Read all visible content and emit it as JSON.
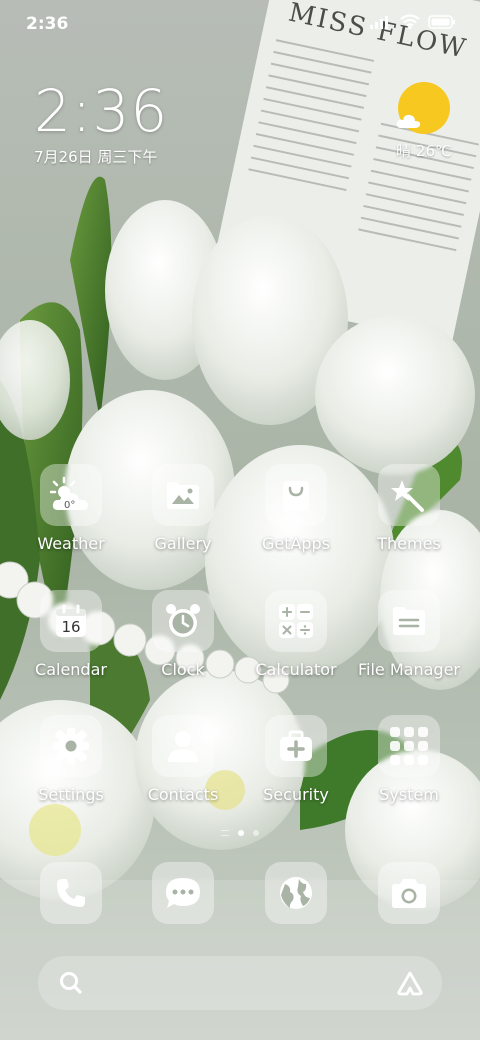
{
  "status_bar": {
    "time": "2:36",
    "icons": [
      "signal-icon",
      "wifi-icon",
      "battery-icon"
    ]
  },
  "clock_widget": {
    "time": "2:36",
    "date": "7月26日 周三下午"
  },
  "weather_widget": {
    "condition_temp": "晴 26℃",
    "icon": "sunny-icon"
  },
  "wallpaper": {
    "book_title": "MISS FLOW"
  },
  "apps": [
    {
      "label": "Weather",
      "icon": "weather-icon",
      "icon_text": "0°"
    },
    {
      "label": "Gallery",
      "icon": "gallery-icon"
    },
    {
      "label": "GetApps",
      "icon": "shopping-bag-icon"
    },
    {
      "label": "Themes",
      "icon": "themes-icon"
    },
    {
      "label": "Calendar",
      "icon": "calendar-icon",
      "icon_text": "16"
    },
    {
      "label": "Clock",
      "icon": "alarm-clock-icon"
    },
    {
      "label": "Calculator",
      "icon": "calculator-icon"
    },
    {
      "label": "File Manager",
      "icon": "folder-icon"
    },
    {
      "label": "Settings",
      "icon": "gear-icon"
    },
    {
      "label": "Contacts",
      "icon": "person-icon"
    },
    {
      "label": "Security",
      "icon": "security-icon"
    },
    {
      "label": "System",
      "icon": "app-folder-icon"
    }
  ],
  "dock": [
    {
      "icon": "phone-icon"
    },
    {
      "icon": "messages-icon"
    },
    {
      "icon": "browser-icon"
    },
    {
      "icon": "camera-icon"
    }
  ],
  "page_indicator": {
    "pages": 3,
    "current": 2
  },
  "search_bar": {
    "left_icon": "search-icon",
    "right_icon": "assistant-icon"
  },
  "colors": {
    "sun": "#f7c820",
    "icon_glass": "rgba(255,255,255,0.38)"
  }
}
